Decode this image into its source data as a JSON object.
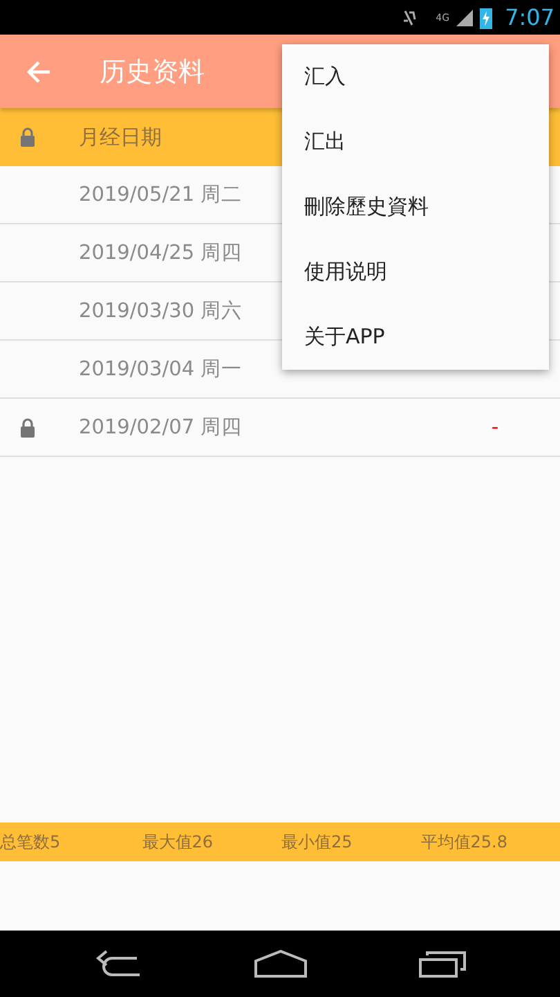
{
  "status_bar": {
    "time": "7:07",
    "network": "4G"
  },
  "app_bar": {
    "title": "历史资料"
  },
  "table_header": {
    "locked": true,
    "label": "月经日期"
  },
  "rows": [
    {
      "date": "2019/05/21 周二",
      "locked": false
    },
    {
      "date": "2019/04/25 周四",
      "locked": false
    },
    {
      "date": "2019/03/30 周六",
      "locked": false
    },
    {
      "date": "2019/03/04 周一",
      "locked": false
    },
    {
      "date": "2019/02/07 周四",
      "locked": true,
      "value": "-",
      "color": "#ff0000"
    }
  ],
  "menu": [
    "汇入",
    "汇出",
    "刪除歷史資料",
    "使用说明",
    "关于APP"
  ],
  "summary": [
    "总笔数5",
    "最大值26",
    "最小值25",
    "平均值25.8"
  ]
}
